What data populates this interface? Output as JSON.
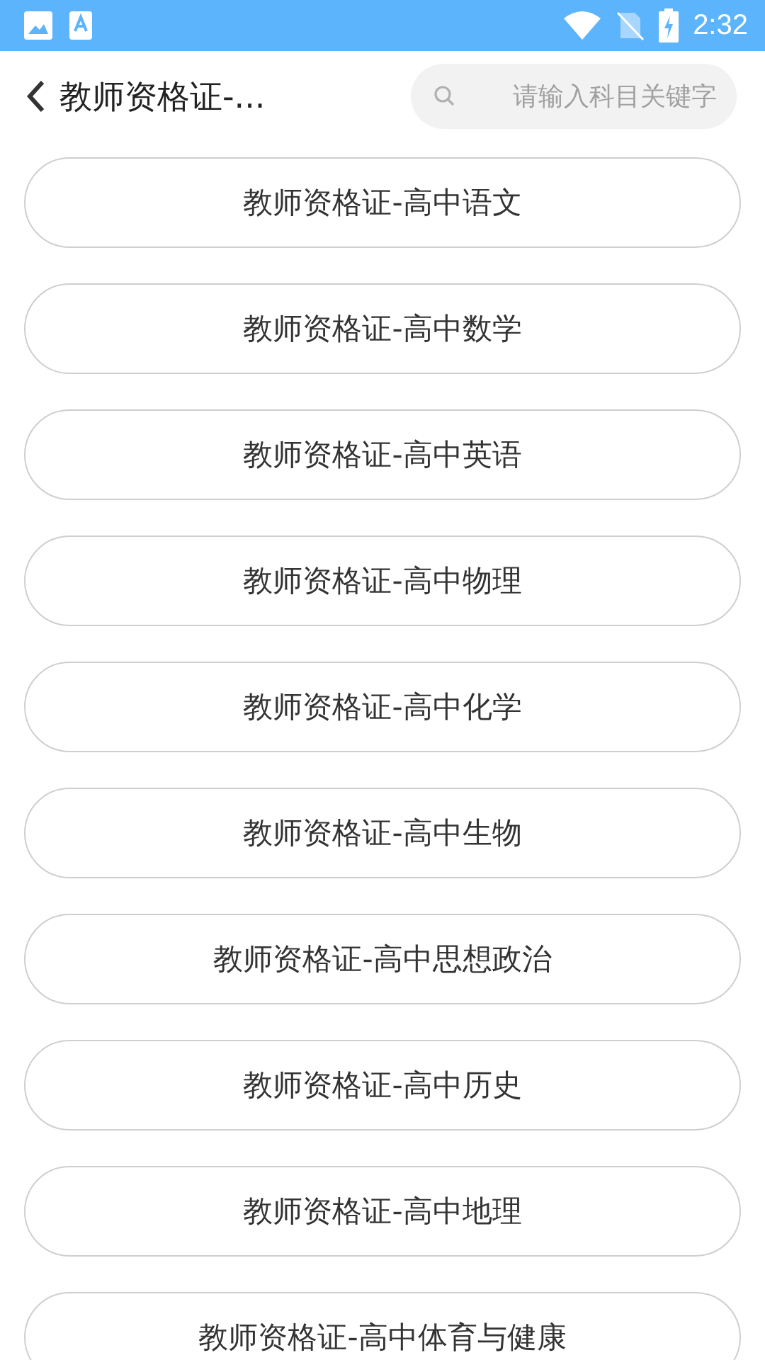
{
  "status_bar": {
    "time": "2:32"
  },
  "header": {
    "title": "教师资格证-...",
    "search": {
      "placeholder": "请输入科目关键字"
    }
  },
  "subjects": [
    {
      "label": "教师资格证-高中语文"
    },
    {
      "label": "教师资格证-高中数学"
    },
    {
      "label": "教师资格证-高中英语"
    },
    {
      "label": "教师资格证-高中物理"
    },
    {
      "label": "教师资格证-高中化学"
    },
    {
      "label": "教师资格证-高中生物"
    },
    {
      "label": "教师资格证-高中思想政治"
    },
    {
      "label": "教师资格证-高中历史"
    },
    {
      "label": "教师资格证-高中地理"
    },
    {
      "label": "教师资格证-高中体育与健康"
    }
  ]
}
